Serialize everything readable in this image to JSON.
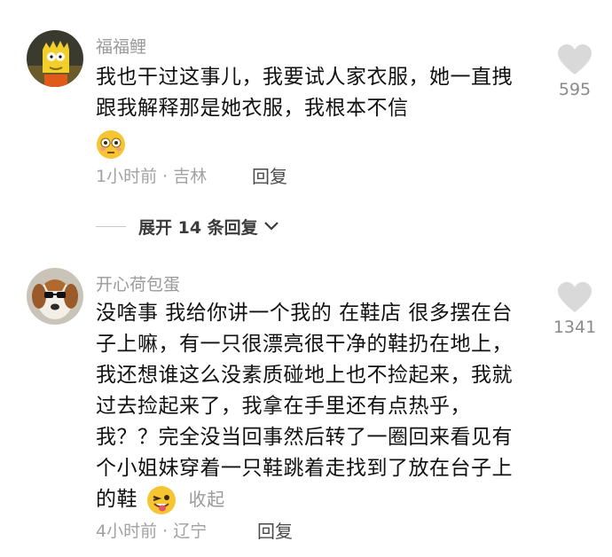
{
  "comments": [
    {
      "username": "福福鲤",
      "text": "我也干过这事儿，我要试人家衣服，她一直拽跟我解释那是她衣服，我根本不信",
      "emoji": "flushed-emoji",
      "time_location": "1小时前 · 吉林",
      "reply_label": "回复",
      "likes": "595"
    },
    {
      "username": "开心荷包蛋",
      "text": "没啥事 我给你讲一个我的 在鞋店 很多摆在台子上嘛，有一只很漂亮很干净的鞋扔在地上，我还想谁这么没素质碰地上也不捡起来，我就过去捡起来了，我拿在手里还有点热乎，我？？完全没当回事然后转了一圈回来看见有个小姐妹穿着一只鞋跳着走找到了放在台子上的鞋",
      "emoji": "winking-tongue-emoji",
      "collapse_label": "收起",
      "time_location": "4小时前 · 辽宁",
      "reply_label": "回复",
      "likes": "1341"
    }
  ],
  "expand_replies": {
    "label": "展开 14 条回复"
  },
  "colors": {
    "heart": "#d9d9d9",
    "emoji_face": "#f6c531"
  }
}
